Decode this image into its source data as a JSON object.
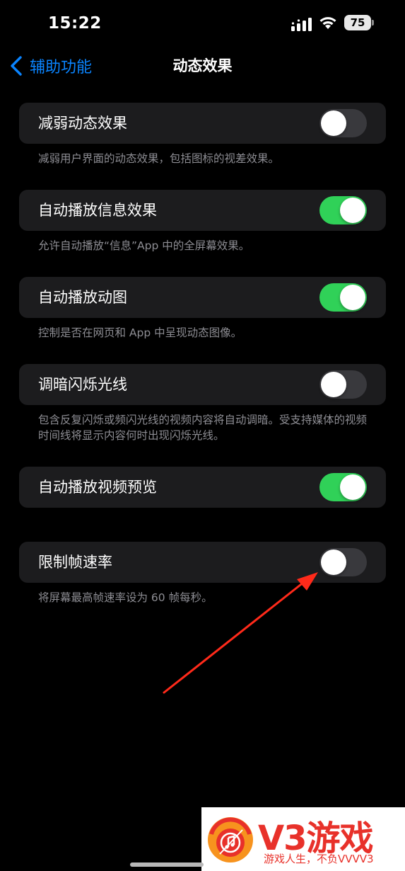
{
  "status_bar": {
    "time": "15:22",
    "battery": "75"
  },
  "nav": {
    "back_label": "辅助功能",
    "title": "动态效果"
  },
  "settings": [
    {
      "label": "减弱动态效果",
      "enabled": false,
      "footer": "减弱用户界面的动态效果，包括图标的视差效果。"
    },
    {
      "label": "自动播放信息效果",
      "enabled": true,
      "footer": "允许自动播放“信息”App 中的全屏幕效果。"
    },
    {
      "label": "自动播放动图",
      "enabled": true,
      "footer": "控制是否在网页和 App 中呈现动态图像。"
    },
    {
      "label": "调暗闪烁光线",
      "enabled": false,
      "footer": "包含反复闪烁或频闪光线的视频内容将自动调暗。受支持媒体的视频时间线将显示内容何时出现闪烁光线。"
    },
    {
      "label": "自动播放视频预览",
      "enabled": true,
      "footer": ""
    },
    {
      "label": "限制帧速率",
      "enabled": false,
      "footer": "将屏幕最高帧速率设为 60 帧每秒。"
    }
  ],
  "watermark": {
    "brand": "V3",
    "brand_suffix": "游戏",
    "slogan": "游戏人生，不负VVVV3"
  },
  "colors": {
    "accent": "#0a84ff",
    "toggle_on": "#30d158",
    "toggle_off": "#39393d",
    "cell_bg": "#1c1c1e",
    "annotation_arrow": "#ff2a1a"
  }
}
